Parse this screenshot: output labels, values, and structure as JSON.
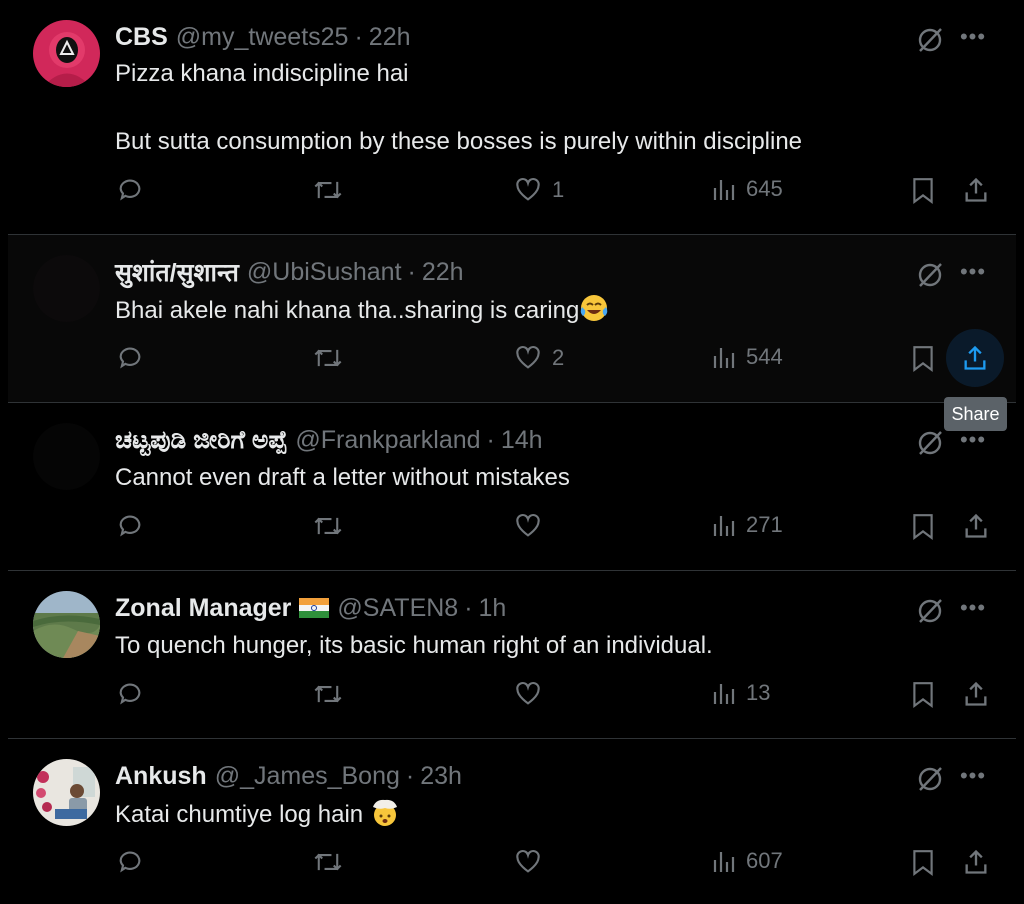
{
  "tooltip": "Share",
  "tweets": [
    {
      "name": "CBS",
      "handle": "@my_tweets25",
      "dot": "·",
      "time": "22h",
      "text": "Pizza khana indiscipline hai\n\nBut sutta consumption by these bosses is purely within discipline",
      "likes": "1",
      "views": "645"
    },
    {
      "name": "सुशांत/सुशान्त",
      "handle": "@UbiSushant",
      "dot": "·",
      "time": "22h",
      "text": "Bhai akele nahi khana tha..sharing is caring",
      "emoji": "face-with-tears-of-joy",
      "likes": "2",
      "views": "544"
    },
    {
      "name": "ಚಟ್ಟಪುಡಿ ಜೀರಿಗೆ ಅಪ್ಪೆ",
      "handle": "@Frankparkland",
      "dot": "·",
      "time": "14h",
      "text": "Cannot even draft a letter without mistakes",
      "likes": "",
      "views": "271"
    },
    {
      "name": "Zonal Manager",
      "flag": "india-flag",
      "handle": "@SATEN8",
      "dot": "·",
      "time": "1h",
      "text": "To quench hunger, its basic human right of an individual.",
      "likes": "",
      "views": "13"
    },
    {
      "name": "Ankush",
      "handle": "@_James_Bong",
      "dot": "·",
      "time": "23h",
      "text": "Katai chumtiye log hain",
      "emoji": "exploding-head",
      "likes": "",
      "views": "607"
    }
  ],
  "icons": {
    "reply": "reply-icon",
    "retweet": "retweet-icon",
    "like": "heart-icon",
    "views": "views-icon",
    "bookmark": "bookmark-icon",
    "share": "share-icon",
    "grok": "grok-icon",
    "more": "more-icon"
  },
  "colors": {
    "background": "#000000",
    "text": "#e7e9ea",
    "muted": "#71767b",
    "divider": "#2f3336",
    "accent": "#1d9bf0"
  }
}
